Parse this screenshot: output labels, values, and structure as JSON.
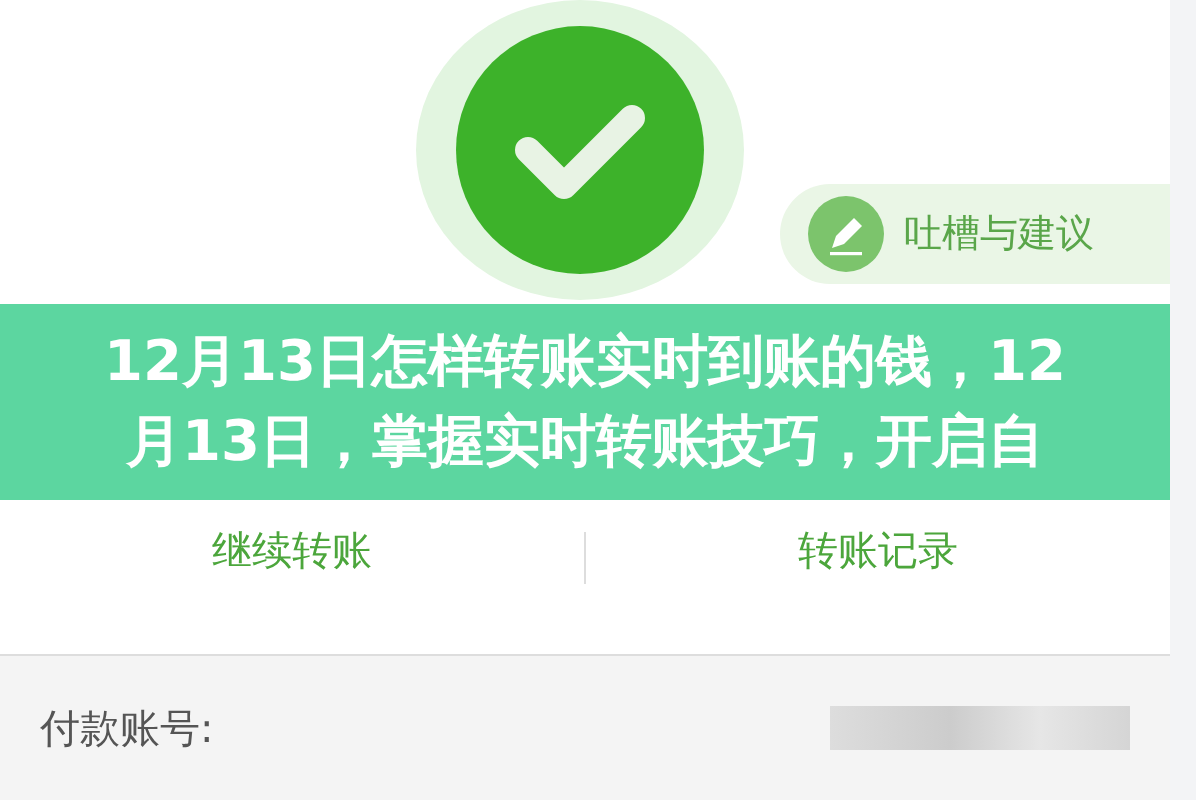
{
  "feedback_button": {
    "label": "吐槽与建议"
  },
  "headline_lines": [
    "12月13日怎样转账实时到账的钱，12",
    "月13日，掌握实时转账技巧，开启自"
  ],
  "actions": [
    {
      "label": "继续转账"
    },
    {
      "label": "转账记录"
    }
  ],
  "payment_account": {
    "label": "付款账号:"
  }
}
